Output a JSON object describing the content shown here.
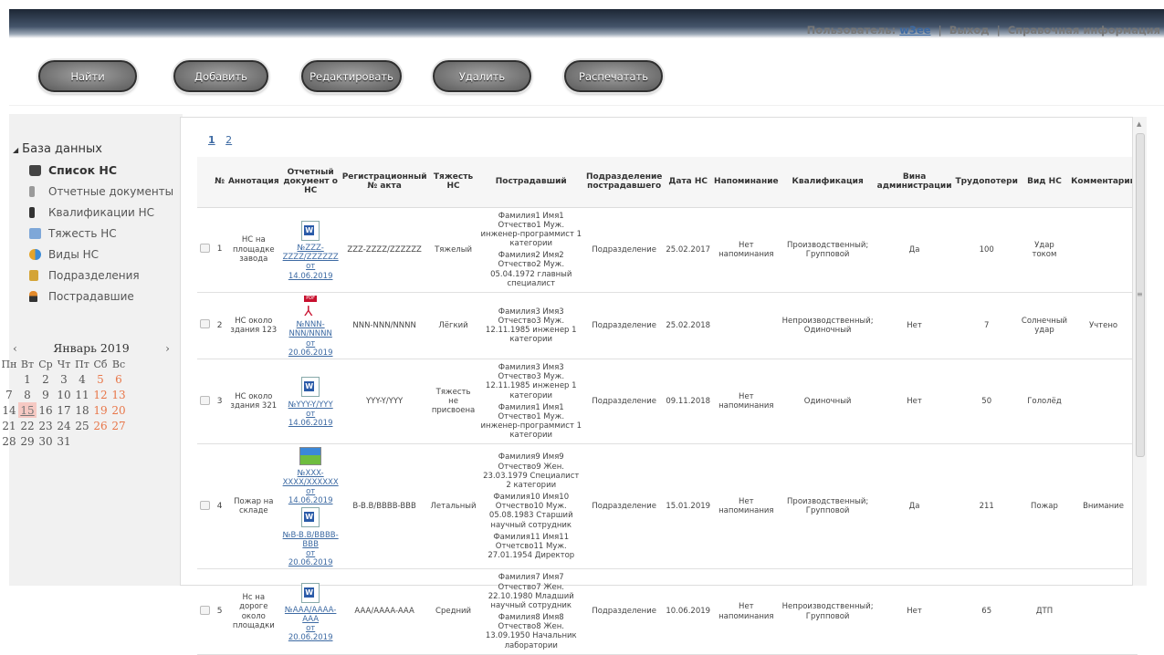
{
  "header": {
    "user_label": "Пользователь:",
    "user_name": "w3ee",
    "logout": "Выход",
    "help": "Справочная информация"
  },
  "toolbar": {
    "find": "Найти",
    "add": "Добавить",
    "edit": "Редактировать",
    "delete": "Удалить",
    "print": "Распечатать"
  },
  "tree": {
    "root": "База данных",
    "items": [
      "Список НС",
      "Отчетные документы",
      "Квалификации НС",
      "Тяжесть НС",
      "Виды НС",
      "Подразделения",
      "Пострадавшие"
    ]
  },
  "calendar": {
    "prev": "‹",
    "next": "›",
    "month": "Январь 2019",
    "days": [
      "Пн",
      "Вт",
      "Ср",
      "Чт",
      "Пт",
      "Сб",
      "Вс"
    ],
    "today": "15"
  },
  "pager": {
    "p1": "1",
    "p2": "2"
  },
  "columns": [
    "№",
    "Аннотация",
    "Отчетный документ о НС",
    "Регистрационный № акта",
    "Тяжесть НС",
    "Пострадавший",
    "Подразделение пострадавшего",
    "Дата НС",
    "Напоминание",
    "Квалификация",
    "Вина администрации",
    "Трудопотери",
    "Вид НС",
    "Комментарии"
  ],
  "rows": [
    {
      "n": "1",
      "ann": "НС на площадке завода",
      "docs": [
        {
          "icon": "word-icon",
          "link": "№ZZZ-ZZZZ/ZZZZZZ",
          "date": "от 14.06.2019"
        }
      ],
      "reg": "ZZZ-ZZZZ/ZZZZZZ",
      "sev": "Тяжелый",
      "victims": [
        "Фамилия1 Имя1 Отчество1 Муж. инженер-программист 1 категории",
        "Фамилия2 Имя2 Отчество2 Муж. 05.04.1972 главный специалист"
      ],
      "dept": "Подразделение",
      "date": "25.02.2017",
      "remind": "Нет напоминания",
      "qual": "Производственный; Групповой",
      "guilt": "Да",
      "loss": "100",
      "kind": "Удар током",
      "comment": ""
    },
    {
      "n": "2",
      "ann": "НС около здания 123",
      "docs": [
        {
          "icon": "pdf-icon",
          "link": "№NNN-NNN/NNNN",
          "date": "от 20.06.2019"
        }
      ],
      "reg": "NNN-NNN/NNNN",
      "sev": "Лёгкий",
      "victims": [
        "Фамилия3 Имя3 Отчество3 Муж. 12.11.1985 инженер 1 категории"
      ],
      "dept": "Подразделение",
      "date": "25.02.2018",
      "remind": "",
      "qual": "Непроизводственный; Одиночный",
      "guilt": "Нет",
      "loss": "7",
      "kind": "Солнечный удар",
      "comment": "Учтено"
    },
    {
      "n": "3",
      "ann": "НС около здания 321",
      "docs": [
        {
          "icon": "word-icon",
          "link": "№YYY-Y/YYY",
          "date": "от 14.06.2019"
        }
      ],
      "reg": "YYY-Y/YYY",
      "sev": "Тяжесть не присвоена",
      "victims": [
        "Фамилия3 Имя3 Отчество3 Муж. 12.11.1985 инженер 1 категории",
        "Фамилия1 Имя1 Отчество1 Муж. инженер-программист 1 категории"
      ],
      "dept": "Подразделение",
      "date": "09.11.2018",
      "remind": "Нет напоминания",
      "qual": "Одиночный",
      "guilt": "Нет",
      "loss": "50",
      "kind": "Гололёд",
      "comment": ""
    },
    {
      "n": "4",
      "ann": "Пожар на складе",
      "docs": [
        {
          "icon": "image-icon",
          "link": "№XXX-XXXX/XXXXXX",
          "date": "от 14.06.2019"
        },
        {
          "icon": "word-icon",
          "link": "№B-B.B/BBBB-BBB",
          "date": "от 20.06.2019"
        }
      ],
      "reg": "B-B.B/BBBB-BBB",
      "sev": "Летальный",
      "victims": [
        "Фамилия9 Имя9 Отчество9 Жен. 23.03.1979 Специалист 2 категории",
        "Фамилия10 Имя10 Отчество10 Муж. 05.08.1983 Старший научный сотрудник",
        "Фамилия11 Имя11 Отчетсво11 Муж. 27.01.1954 Директор"
      ],
      "dept": "Подразделение",
      "date": "15.01.2019",
      "remind": "Нет напоминания",
      "qual": "Производственный; Групповой",
      "guilt": "Да",
      "loss": "211",
      "kind": "Пожар",
      "comment": "Внимание"
    },
    {
      "n": "5",
      "ann": "Нс на дороге около площадки",
      "docs": [
        {
          "icon": "word-icon",
          "link": "№AAA/AAAA-AAA",
          "date": "от 20.06.2019"
        }
      ],
      "reg": "AAA/AAAA-AAA",
      "sev": "Средний",
      "victims": [
        "Фамилия7 Имя7 Отчество7 Жен. 22.10.1980 Младший научный сотрудник",
        "Фамилия8 Имя8 Отчество8 Жен. 13.09.1950 Начальник лаборатории"
      ],
      "dept": "Подразделение",
      "date": "10.06.2019",
      "remind": "Нет напоминания",
      "qual": "Непроизводственный; Групповой",
      "guilt": "Нет",
      "loss": "65",
      "kind": "ДТП",
      "comment": ""
    }
  ]
}
